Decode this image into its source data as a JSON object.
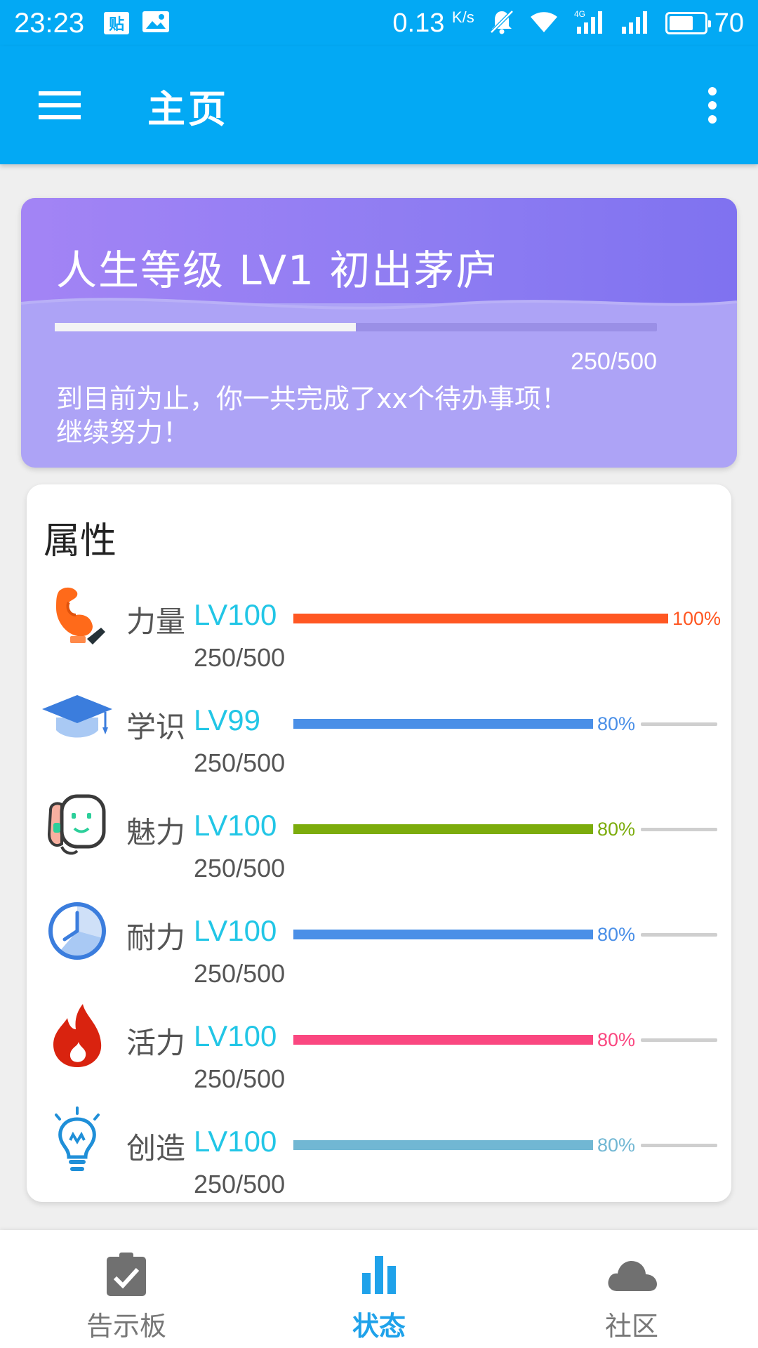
{
  "status_bar": {
    "time": "23:23",
    "notif_badge": "贴",
    "net_speed": "0.13",
    "net_speed_unit": "K/s",
    "net_type": "4G",
    "battery": "70",
    "battery_level": 0.7
  },
  "app_bar": {
    "title": "主页",
    "menu_icon": "hamburger-menu-icon",
    "more_icon": "more-vert-icon"
  },
  "level_card": {
    "title": "人生等级 LV1 初出茅庐",
    "progress_text": "250/500",
    "progress": 0.5,
    "message_line1": "到目前为止，你一共完成了xx个待办事项！",
    "message_line2": "继续努力！"
  },
  "attributes": {
    "heading": "属性",
    "items": [
      {
        "name": "力量",
        "level": "LV100",
        "progress_text": "250/500",
        "percent_text": "100%",
        "percent": 100,
        "color": "#ff5722",
        "icon": "muscle-arm-icon"
      },
      {
        "name": "学识",
        "level": "LV99",
        "progress_text": "250/500",
        "percent_text": "80%",
        "percent": 80,
        "color": "#4a8fe7",
        "icon": "graduation-cap-icon"
      },
      {
        "name": "魅力",
        "level": "LV100",
        "progress_text": "250/500",
        "percent_text": "80%",
        "percent": 80,
        "color": "#7cac0c",
        "icon": "face-mask-icon"
      },
      {
        "name": "耐力",
        "level": "LV100",
        "progress_text": "250/500",
        "percent_text": "80%",
        "percent": 80,
        "color": "#4a8fe7",
        "icon": "stopwatch-icon"
      },
      {
        "name": "活力",
        "level": "LV100",
        "progress_text": "250/500",
        "percent_text": "80%",
        "percent": 80,
        "color": "#fa4780",
        "icon": "flame-icon"
      },
      {
        "name": "创造",
        "level": "LV100",
        "progress_text": "250/500",
        "percent_text": "80%",
        "percent": 80,
        "color": "#71b7d3",
        "icon": "lightbulb-icon"
      }
    ]
  },
  "bottom_nav": {
    "tabs": [
      {
        "label": "告示板",
        "icon": "clipboard-check-icon",
        "active": false
      },
      {
        "label": "状态",
        "icon": "bar-chart-icon",
        "active": true
      },
      {
        "label": "社区",
        "icon": "cloud-icon",
        "active": false
      }
    ]
  },
  "colors": {
    "primary": "#03a9f4",
    "level_card": "#ada3f6",
    "level_value": "#22c6e6",
    "active_tab": "#1fa2ea"
  }
}
